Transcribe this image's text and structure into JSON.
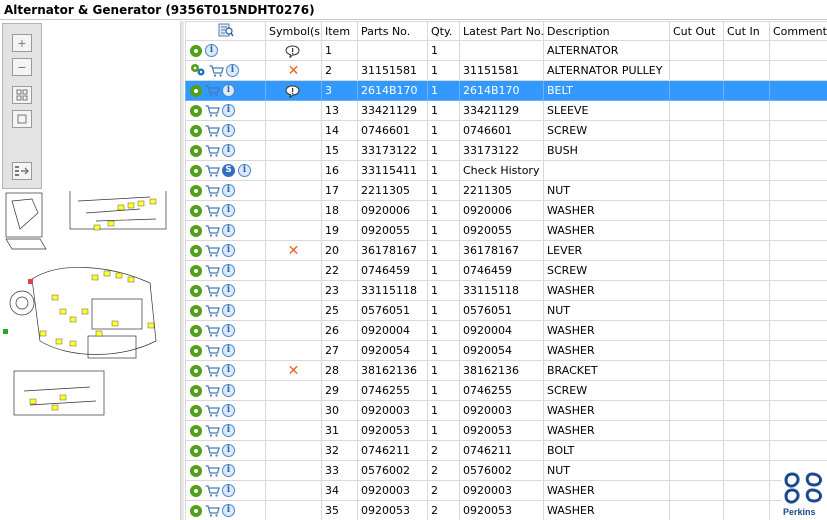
{
  "window": {
    "title": "Alternator & Generator (9356T015NDHT0276)"
  },
  "toolbar": {
    "tools": [
      "zoom-in",
      "zoom-out",
      "fit-all",
      "actual-size",
      "show-list"
    ]
  },
  "table": {
    "columns": [
      "Symbol(s)",
      "Item",
      "Parts No.",
      "Qty.",
      "Latest Part No.",
      "Description",
      "Cut Out",
      "Cut In",
      "Comment"
    ],
    "rows": [
      {
        "icons": [
          "gear",
          "info"
        ],
        "symbol": "bubble",
        "item": "1",
        "part_no": "",
        "qty": "1",
        "latest": "",
        "desc": "ALTERNATOR"
      },
      {
        "icons": [
          "gears",
          "cart",
          "info"
        ],
        "symbol": "cross",
        "item": "2",
        "part_no": "31151581",
        "qty": "1",
        "latest": "31151581",
        "desc": "ALTERNATOR PULLEY"
      },
      {
        "icons": [
          "gear",
          "cart",
          "info"
        ],
        "symbol": "bubble",
        "item": "3",
        "part_no": "2614B170",
        "qty": "1",
        "latest": "2614B170",
        "desc": "BELT",
        "selected": true
      },
      {
        "icons": [
          "gear",
          "cart",
          "info"
        ],
        "symbol": "",
        "item": "13",
        "part_no": "33421129",
        "qty": "1",
        "latest": "33421129",
        "desc": "SLEEVE"
      },
      {
        "icons": [
          "gear",
          "cart",
          "info"
        ],
        "symbol": "",
        "item": "14",
        "part_no": "0746601",
        "qty": "1",
        "latest": "0746601",
        "desc": "SCREW"
      },
      {
        "icons": [
          "gear",
          "cart",
          "info"
        ],
        "symbol": "",
        "item": "15",
        "part_no": "33173122",
        "qty": "1",
        "latest": "33173122",
        "desc": "BUSH"
      },
      {
        "icons": [
          "gear",
          "cart",
          "s",
          "info"
        ],
        "symbol": "",
        "item": "16",
        "part_no": "33115411",
        "qty": "1",
        "latest": "Check History",
        "desc": ""
      },
      {
        "icons": [
          "gear",
          "cart",
          "info"
        ],
        "symbol": "",
        "item": "17",
        "part_no": "2211305",
        "qty": "1",
        "latest": "2211305",
        "desc": "NUT"
      },
      {
        "icons": [
          "gear",
          "cart",
          "info"
        ],
        "symbol": "",
        "item": "18",
        "part_no": "0920006",
        "qty": "1",
        "latest": "0920006",
        "desc": "WASHER"
      },
      {
        "icons": [
          "gear",
          "cart",
          "info"
        ],
        "symbol": "",
        "item": "19",
        "part_no": "0920055",
        "qty": "1",
        "latest": "0920055",
        "desc": "WASHER"
      },
      {
        "icons": [
          "gear",
          "cart",
          "info"
        ],
        "symbol": "cross",
        "item": "20",
        "part_no": "36178167",
        "qty": "1",
        "latest": "36178167",
        "desc": "LEVER"
      },
      {
        "icons": [
          "gear",
          "cart",
          "info"
        ],
        "symbol": "",
        "item": "22",
        "part_no": "0746459",
        "qty": "1",
        "latest": "0746459",
        "desc": "SCREW"
      },
      {
        "icons": [
          "gear",
          "cart",
          "info"
        ],
        "symbol": "",
        "item": "23",
        "part_no": "33115118",
        "qty": "1",
        "latest": "33115118",
        "desc": "WASHER"
      },
      {
        "icons": [
          "gear",
          "cart",
          "info"
        ],
        "symbol": "",
        "item": "25",
        "part_no": "0576051",
        "qty": "1",
        "latest": "0576051",
        "desc": "NUT"
      },
      {
        "icons": [
          "gear",
          "cart",
          "info"
        ],
        "symbol": "",
        "item": "26",
        "part_no": "0920004",
        "qty": "1",
        "latest": "0920004",
        "desc": "WASHER"
      },
      {
        "icons": [
          "gear",
          "cart",
          "info"
        ],
        "symbol": "",
        "item": "27",
        "part_no": "0920054",
        "qty": "1",
        "latest": "0920054",
        "desc": "WASHER"
      },
      {
        "icons": [
          "gear",
          "cart",
          "info"
        ],
        "symbol": "cross",
        "item": "28",
        "part_no": "38162136",
        "qty": "1",
        "latest": "38162136",
        "desc": "BRACKET"
      },
      {
        "icons": [
          "gear",
          "cart",
          "info"
        ],
        "symbol": "",
        "item": "29",
        "part_no": "0746255",
        "qty": "1",
        "latest": "0746255",
        "desc": "SCREW"
      },
      {
        "icons": [
          "gear",
          "cart",
          "info"
        ],
        "symbol": "",
        "item": "30",
        "part_no": "0920003",
        "qty": "1",
        "latest": "0920003",
        "desc": "WASHER"
      },
      {
        "icons": [
          "gear",
          "cart",
          "info"
        ],
        "symbol": "",
        "item": "31",
        "part_no": "0920053",
        "qty": "1",
        "latest": "0920053",
        "desc": "WASHER"
      },
      {
        "icons": [
          "gear",
          "cart",
          "info"
        ],
        "symbol": "",
        "item": "32",
        "part_no": "0746211",
        "qty": "2",
        "latest": "0746211",
        "desc": "BOLT"
      },
      {
        "icons": [
          "gear",
          "cart",
          "info"
        ],
        "symbol": "",
        "item": "33",
        "part_no": "0576002",
        "qty": "2",
        "latest": "0576002",
        "desc": "NUT"
      },
      {
        "icons": [
          "gear",
          "cart",
          "info"
        ],
        "symbol": "",
        "item": "34",
        "part_no": "0920003",
        "qty": "2",
        "latest": "0920003",
        "desc": "WASHER"
      },
      {
        "icons": [
          "gear",
          "cart",
          "info"
        ],
        "symbol": "",
        "item": "35",
        "part_no": "0920053",
        "qty": "2",
        "latest": "0920053",
        "desc": "WASHER"
      }
    ]
  },
  "logo": {
    "text": "Perkins",
    "color": "#1b4a8c"
  },
  "colors": {
    "selection": "#3399ff",
    "gear": "#52a01a",
    "cross": "#e8641e"
  }
}
